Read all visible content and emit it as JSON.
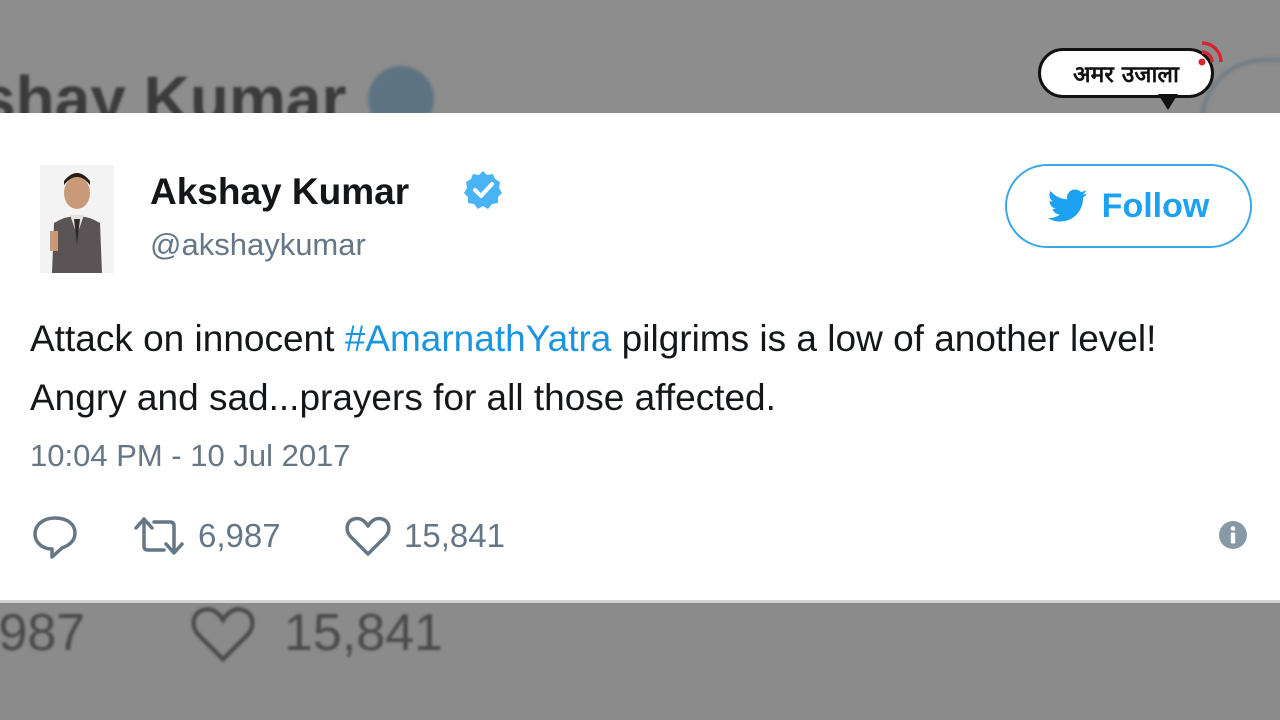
{
  "logo": {
    "text": "अमर उजाला"
  },
  "background": {
    "name": "shay Kumar",
    "retweets": ",987",
    "likes": "15,841"
  },
  "tweet": {
    "author_name": "Akshay Kumar",
    "handle": "@akshaykumar",
    "verified": true,
    "follow_label": "Follow",
    "text_before": "Attack on innocent ",
    "hashtag": "#AmarnathYatra",
    "text_after": " pilgrims is a low of another level! Angry and sad...prayers for all those affected.",
    "timestamp": "10:04 PM - 10 Jul 2017",
    "retweet_count": "6,987",
    "like_count": "15,841"
  },
  "colors": {
    "accent": "#1da1f2",
    "hashtag": "#1b95e0",
    "secondary_text": "#657786",
    "primary_text": "#14171a"
  },
  "icons": [
    "reply-icon",
    "retweet-icon",
    "heart-icon",
    "info-icon",
    "twitter-bird-icon",
    "verified-badge-icon"
  ]
}
